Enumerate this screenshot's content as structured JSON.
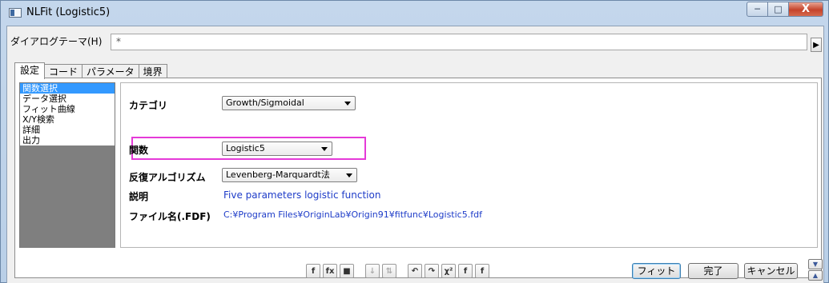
{
  "window": {
    "title": "NLFit (Logistic5)",
    "buttons": {
      "minimize": "─",
      "maximize": "□",
      "close": "X"
    }
  },
  "theme": {
    "label": "ダイアログテーマ(H)",
    "value": "*",
    "arrow": "▶"
  },
  "tabs": [
    {
      "label": "設定",
      "active": true
    },
    {
      "label": "コード",
      "active": false
    },
    {
      "label": "パラメータ",
      "active": false
    },
    {
      "label": "境界",
      "active": false
    }
  ],
  "tree": {
    "items": [
      {
        "label": "関数選択",
        "selected": true
      },
      {
        "label": "データ選択",
        "selected": false
      },
      {
        "label": "フィット曲線",
        "selected": false
      },
      {
        "label": "X/Y検索",
        "selected": false
      },
      {
        "label": "詳細",
        "selected": false
      },
      {
        "label": "出力",
        "selected": false
      }
    ]
  },
  "form": {
    "category": {
      "label": "カテゴリ",
      "value": "Growth/Sigmoidal"
    },
    "function": {
      "label": "関数",
      "value": "Logistic5"
    },
    "algorithm": {
      "label": "反復アルゴリズム",
      "value": "Levenberg-Marquardt法"
    },
    "description": {
      "label": "説明",
      "value": "Five parameters logistic function"
    },
    "filename": {
      "label": "ファイル名(.FDF)",
      "value": "C:¥Program Files¥OriginLab¥Origin91¥fitfunc¥Logistic5.fdf"
    }
  },
  "toolbar": {
    "icons": [
      {
        "name": "fit-formula-icon",
        "glyph": "f",
        "disabled": false
      },
      {
        "name": "function-browser-icon",
        "glyph": "fx",
        "disabled": false
      },
      {
        "name": "save-icon",
        "glyph": "■",
        "disabled": false
      },
      {
        "name": "sort-down-icon",
        "glyph": "↓",
        "disabled": true
      },
      {
        "name": "sort-up-icon",
        "glyph": "⇅",
        "disabled": true
      },
      {
        "name": "init-icon",
        "glyph": "↶",
        "disabled": false
      },
      {
        "name": "reset-icon",
        "glyph": "↷",
        "disabled": false
      },
      {
        "name": "chi-square-icon",
        "glyph": "χ²",
        "disabled": false
      },
      {
        "name": "one-iteration-icon",
        "glyph": "f",
        "disabled": false
      },
      {
        "name": "fit-until-converged-icon",
        "glyph": "f",
        "disabled": false
      }
    ],
    "fit_label": "フィット",
    "done_label": "完了",
    "cancel_label": "キャンセル"
  },
  "colors": {
    "highlight": "#e53ad8",
    "link_blue": "#1e3cc8",
    "selection": "#3399ff"
  }
}
